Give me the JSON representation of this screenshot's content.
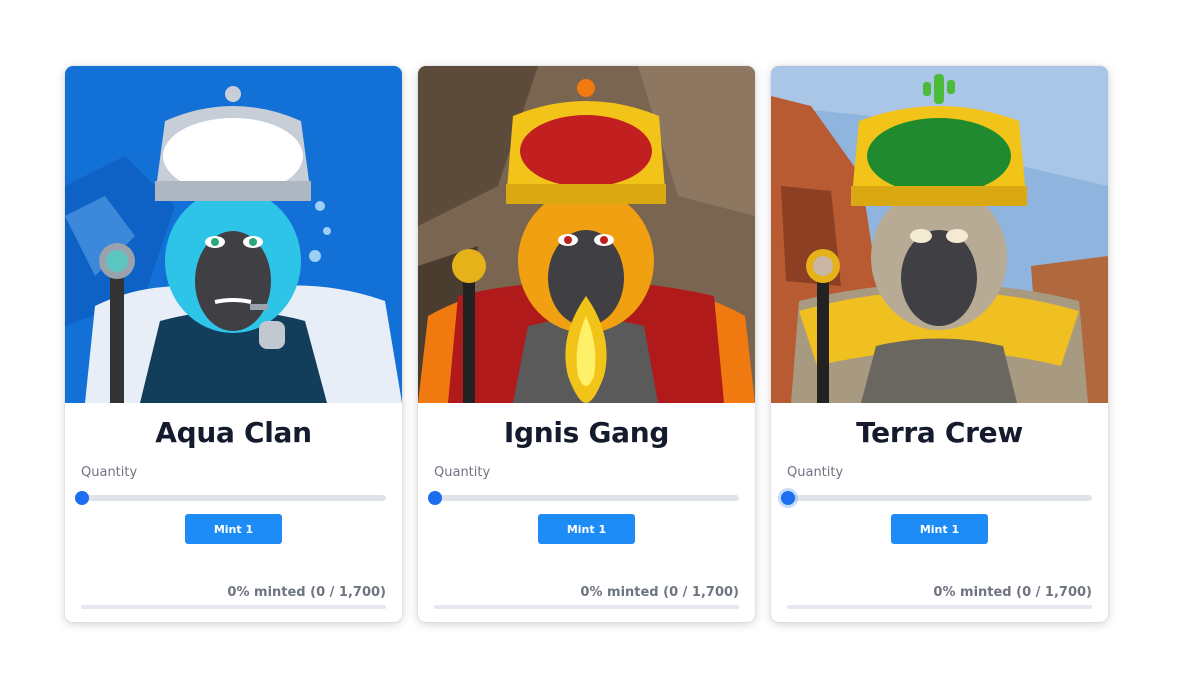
{
  "cards": [
    {
      "title": "Aqua Clan",
      "art": "blue-gorilla-king-underwater-icon",
      "colors": {
        "bg": "#1370d6",
        "fur": "#2ec4e8",
        "crown": "#c7ced8",
        "crown_top": "#ffffff",
        "robe": "#123e5c"
      },
      "quantity_label": "Quantity",
      "slider_value": 1,
      "mint_label": "Mint 1",
      "minted_text": "0% minted (0 / 1,700)",
      "minted_fraction": 0
    },
    {
      "title": "Ignis Gang",
      "art": "fire-gorilla-king-icon",
      "colors": {
        "bg": "#7a6650",
        "fur": "#f0a010",
        "crown": "#f2c41a",
        "crown_top": "#c22020",
        "robe": "#b01a1a"
      },
      "quantity_label": "Quantity",
      "slider_value": 1,
      "mint_label": "Mint 1",
      "minted_text": "0% minted (0 / 1,700)",
      "minted_fraction": 0
    },
    {
      "title": "Terra Crew",
      "art": "earth-gorilla-king-desert-icon",
      "colors": {
        "bg": "#8fb4dd",
        "fur": "#b7ab95",
        "crown": "#f2c41a",
        "crown_top": "#1f8a2e",
        "robe": "#f0c020"
      },
      "quantity_label": "Quantity",
      "slider_value": 1,
      "mint_label": "Mint 1",
      "minted_text": "0% minted (0 / 1,700)",
      "minted_fraction": 0
    }
  ]
}
